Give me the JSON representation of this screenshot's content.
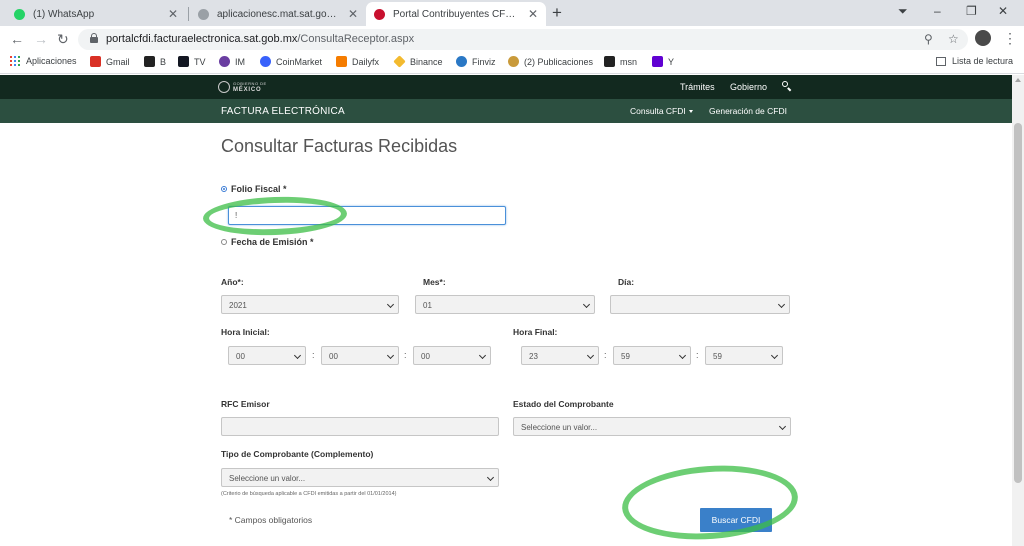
{
  "browser": {
    "tabs": [
      {
        "label": "(1) WhatsApp",
        "icon": "whatsapp-icon",
        "color": "#25d366"
      },
      {
        "label": "aplicacionesc.mat.sat.gob.mx",
        "icon": "globe-icon",
        "color": "#9aa0a6"
      },
      {
        "label": "Portal Contribuyentes CFDI | Busc",
        "icon": "sat-icon",
        "color": "#c8102e"
      }
    ],
    "url_host": "portalcfdi.facturaelectronica.sat.gob.mx",
    "url_path": "/ConsultaReceptor.aspx",
    "bookmarks": [
      {
        "label": "Aplicaciones",
        "icon": "apps-icon"
      },
      {
        "label": "Gmail",
        "icon": "gmail-icon",
        "color": "#d93025"
      },
      {
        "label": "B",
        "icon": "b-icon",
        "color": "#222222"
      },
      {
        "label": "TV",
        "icon": "tradingview-icon",
        "color": "#131722"
      },
      {
        "label": "IM",
        "icon": "im-icon",
        "color": "#6a3ea1"
      },
      {
        "label": "CoinMarket",
        "icon": "coinmarket-icon",
        "color": "#3861fb"
      },
      {
        "label": "Dailyfx",
        "icon": "dailyfx-icon",
        "color": "#f57c00"
      },
      {
        "label": "Binance",
        "icon": "binance-icon",
        "color": "#f3ba2f"
      },
      {
        "label": "Finviz",
        "icon": "finviz-icon",
        "color": "#2a78c5"
      },
      {
        "label": "(2) Publicaciones",
        "icon": "publicaciones-icon",
        "color": "#c99a3a"
      },
      {
        "label": "msn",
        "icon": "msn-icon",
        "color": "#222222"
      },
      {
        "label": "Y",
        "icon": "yahoo-icon",
        "color": "#6001d2"
      }
    ],
    "reading_list": "Lista de lectura"
  },
  "site": {
    "gov_small": "GOBIERNO DE",
    "gov_big": "MÉXICO",
    "nav_tramites": "Trámites",
    "nav_gobierno": "Gobierno",
    "section_title": "FACTURA ELECTRÓNICA",
    "menu_consulta": "Consulta CFDI",
    "menu_generacion": "Generación de CFDI",
    "header_bg": "#12291f",
    "subheader_bg": "#2c4f40"
  },
  "form": {
    "title": "Consultar Facturas Recibidas",
    "folio_label": "Folio Fiscal *",
    "folio_value": "!",
    "fecha_label": "Fecha de Emisión *",
    "anio_label": "Año*:",
    "anio_value": "2021",
    "mes_label": "Mes*:",
    "mes_value": "01",
    "dia_label": "Día:",
    "dia_value": "",
    "hora_inicial_label": "Hora Inicial:",
    "hi_h": "00",
    "hi_m": "00",
    "hi_s": "00",
    "hora_final_label": "Hora Final:",
    "hf_h": "23",
    "hf_m": "59",
    "hf_s": "59",
    "colon": ":",
    "rfc_label": "RFC Emisor",
    "estado_label": "Estado del Comprobante",
    "estado_value": "Seleccione un valor...",
    "tipo_label": "Tipo de Comprobante (Complemento)",
    "tipo_value": "Seleccione un valor...",
    "criterio_note": "(Criterio de búsqueda aplicable a CFDI emitidas a partir del 01/01/2014)",
    "required_note": "* Campos obligatorios",
    "submit_label": "Buscar CFDI",
    "button_color": "#3a80c9"
  }
}
